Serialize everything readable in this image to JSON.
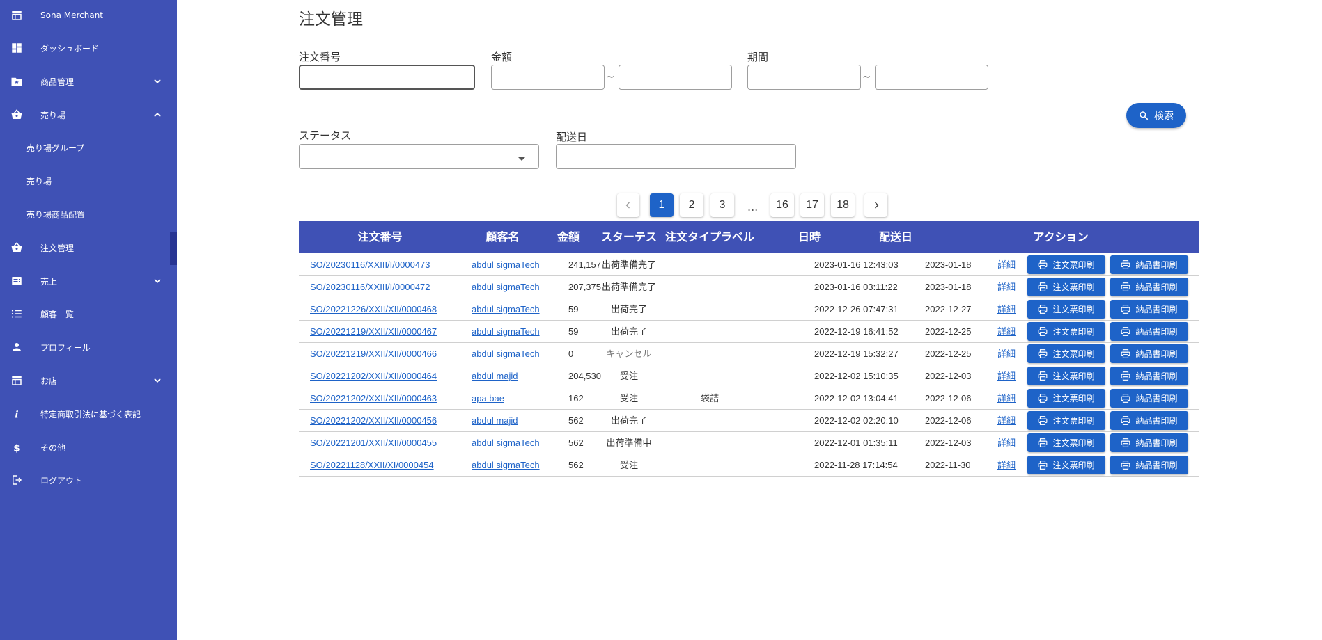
{
  "sidebar": {
    "items": [
      {
        "label": "Sona Merchant",
        "icon": "store-icon"
      },
      {
        "label": "ダッシュボード",
        "icon": "dashboard-icon"
      },
      {
        "label": "商品管理",
        "icon": "product-folder-icon",
        "expand": "down"
      },
      {
        "label": "売り場",
        "icon": "basket-icon",
        "expand": "up"
      },
      {
        "label": "売り場グループ"
      },
      {
        "label": "売り場"
      },
      {
        "label": "売り場商品配置"
      },
      {
        "label": "注文管理",
        "icon": "basket-icon",
        "active": true
      },
      {
        "label": "売上",
        "icon": "receipt-icon",
        "expand": "down"
      },
      {
        "label": "顧客一覧",
        "icon": "list-icon"
      },
      {
        "label": "プロフィール",
        "icon": "person-icon"
      },
      {
        "label": "お店",
        "icon": "store-icon",
        "expand": "down"
      },
      {
        "label": "特定商取引法に基づく表記",
        "icon": "info-icon"
      },
      {
        "label": "その他",
        "icon": "dollar-icon"
      },
      {
        "label": "ログアウト",
        "icon": "logout-icon"
      }
    ]
  },
  "page": {
    "title": "注文管理"
  },
  "filters": {
    "order_number_label": "注文番号",
    "order_number_value": "",
    "amount_label": "金額",
    "period_label": "期間",
    "tilde": "~",
    "status_label": "ステータス",
    "delivery_date_label": "配送日",
    "search_button": "検索"
  },
  "pagination": {
    "pages": [
      "1",
      "2",
      "3",
      "16",
      "17",
      "18"
    ],
    "current": "1",
    "ellipsis": "..."
  },
  "table": {
    "headers": [
      "注文番号",
      "顧客名",
      "金額",
      "スターテス",
      "注文タイプラベル",
      "日時",
      "配送日",
      "アクション"
    ],
    "detail_label": "詳細",
    "print_order_label": "注文票印刷",
    "print_delivery_label": "納品書印刷",
    "rows": [
      {
        "order": "SO/20230116/XXIII/I/0000473",
        "customer": "abdul sigmaTech",
        "amount": "241,157",
        "status": "出荷準備完了",
        "type_label": "",
        "datetime": "2023-01-16 12:43:03",
        "delivery": "2023-01-18"
      },
      {
        "order": "SO/20230116/XXIII/I/0000472",
        "customer": "abdul sigmaTech",
        "amount": "207,375",
        "status": "出荷準備完了",
        "type_label": "",
        "datetime": "2023-01-16 03:11:22",
        "delivery": "2023-01-18"
      },
      {
        "order": "SO/20221226/XXII/XII/0000468",
        "customer": "abdul sigmaTech",
        "amount": "59",
        "status": "出荷完了",
        "type_label": "",
        "datetime": "2022-12-26 07:47:31",
        "delivery": "2022-12-27"
      },
      {
        "order": "SO/20221219/XXII/XII/0000467",
        "customer": "abdul sigmaTech",
        "amount": "59",
        "status": "出荷完了",
        "type_label": "",
        "datetime": "2022-12-19 16:41:52",
        "delivery": "2022-12-25"
      },
      {
        "order": "SO/20221219/XXII/XII/0000466",
        "customer": "abdul sigmaTech",
        "amount": "0",
        "status": "キャンセル",
        "type_label": "",
        "datetime": "2022-12-19 15:32:27",
        "delivery": "2022-12-25"
      },
      {
        "order": "SO/20221202/XXII/XII/0000464",
        "customer": "abdul majid",
        "amount": "204,530",
        "status": "受注",
        "type_label": "",
        "datetime": "2022-12-02 15:10:35",
        "delivery": "2022-12-03"
      },
      {
        "order": "SO/20221202/XXII/XII/0000463",
        "customer": "apa bae",
        "amount": "162",
        "status": "受注",
        "type_label": "袋詰",
        "datetime": "2022-12-02 13:04:41",
        "delivery": "2022-12-06"
      },
      {
        "order": "SO/20221202/XXII/XII/0000456",
        "customer": "abdul majid",
        "amount": "562",
        "status": "出荷完了",
        "type_label": "",
        "datetime": "2022-12-02 02:20:10",
        "delivery": "2022-12-06"
      },
      {
        "order": "SO/20221201/XXII/XII/0000455",
        "customer": "abdul sigmaTech",
        "amount": "562",
        "status": "出荷準備中",
        "type_label": "",
        "datetime": "2022-12-01 01:35:11",
        "delivery": "2022-12-03"
      },
      {
        "order": "SO/20221128/XXII/XI/0000454",
        "customer": "abdul sigmaTech",
        "amount": "562",
        "status": "受注",
        "type_label": "",
        "datetime": "2022-11-28 17:14:54",
        "delivery": "2022-11-30"
      }
    ]
  },
  "colors": {
    "sidebar": "#3f51b5",
    "primary": "#1e63c8",
    "cancelled_text": "#757575"
  }
}
